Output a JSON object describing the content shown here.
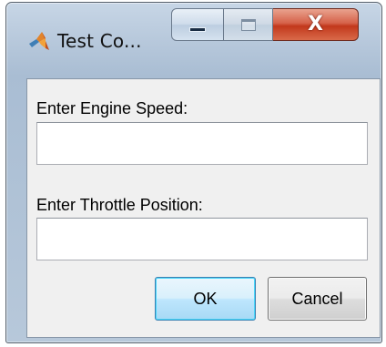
{
  "window": {
    "title": "Test Co...",
    "app_icon": "matlab-icon",
    "caption_buttons": {
      "minimize_icon": "minimize-icon",
      "maximize_icon": "maximize-icon",
      "close_icon": "close-icon",
      "close_glyph": "X"
    }
  },
  "form": {
    "engine_speed": {
      "label": "Enter Engine Speed:",
      "value": ""
    },
    "throttle_position": {
      "label": "Enter Throttle Position:",
      "value": ""
    }
  },
  "buttons": {
    "ok_label": "OK",
    "cancel_label": "Cancel"
  },
  "colors": {
    "close_button": "#c7432a",
    "ok_button_border": "#3c7fb1",
    "client_background": "#f0f0f0",
    "frame": "#b8c9dc"
  }
}
